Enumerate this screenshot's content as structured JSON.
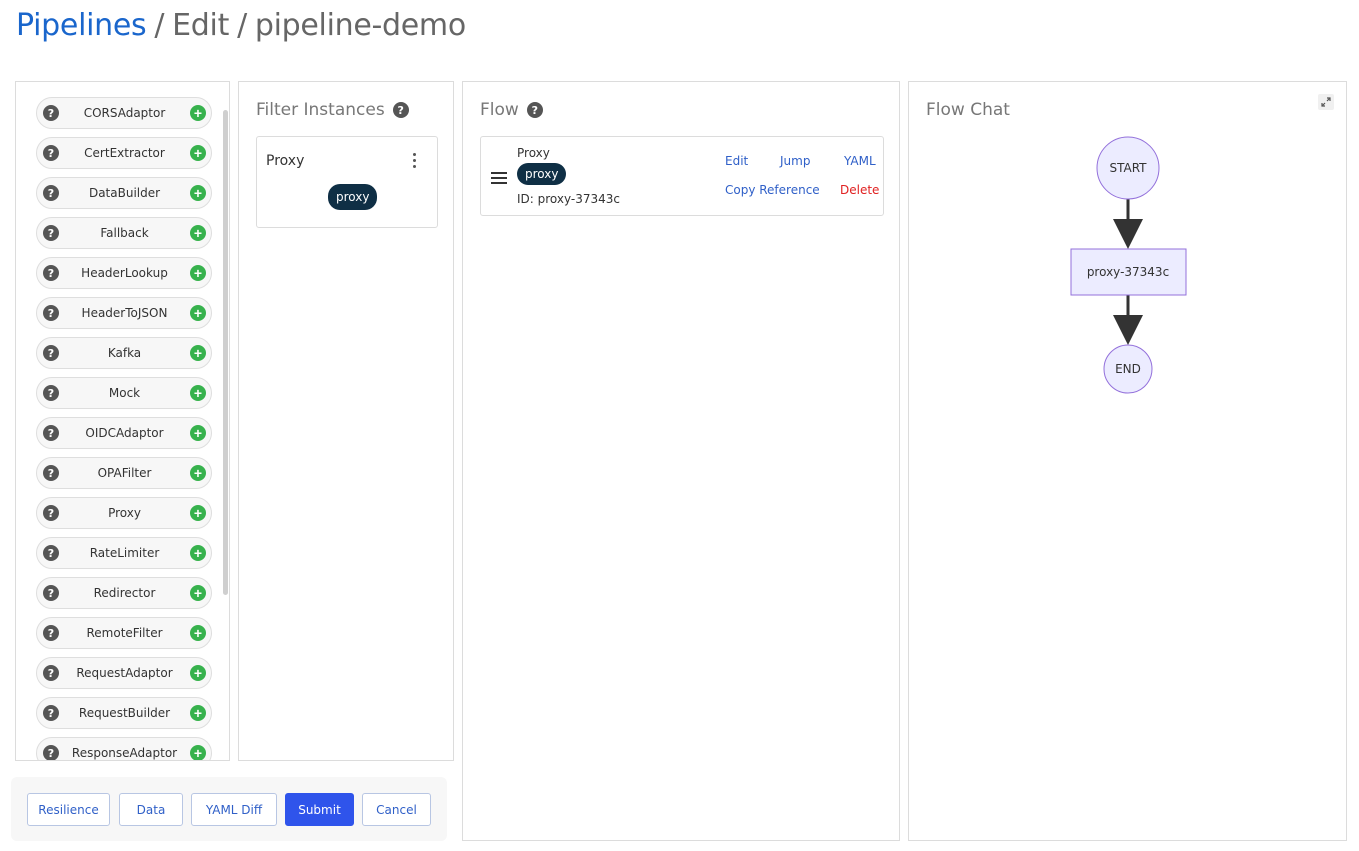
{
  "breadcrumb": {
    "root": "Pipelines",
    "separator": "/",
    "action": "Edit",
    "name": "pipeline-demo"
  },
  "filters": {
    "items": [
      "CORSAdaptor",
      "CertExtractor",
      "DataBuilder",
      "Fallback",
      "HeaderLookup",
      "HeaderToJSON",
      "Kafka",
      "Mock",
      "OIDCAdaptor",
      "OPAFilter",
      "Proxy",
      "RateLimiter",
      "Redirector",
      "RemoteFilter",
      "RequestAdaptor",
      "RequestBuilder",
      "ResponseAdaptor"
    ]
  },
  "instances": {
    "title": "Filter Instances",
    "card": {
      "kind": "Proxy",
      "tag": "proxy"
    }
  },
  "flow": {
    "title": "Flow",
    "card": {
      "kind": "Proxy",
      "tag": "proxy",
      "id_text": "ID: proxy-37343c",
      "actions": {
        "edit": "Edit",
        "jump": "Jump",
        "yaml": "YAML",
        "copy_reference": "Copy Reference",
        "delete": "Delete"
      }
    }
  },
  "chart": {
    "title": "Flow Chat",
    "start_label": "START",
    "node_label": "proxy-37343c",
    "end_label": "END"
  },
  "actions": {
    "resilience": "Resilience",
    "data": "Data",
    "yaml_diff": "YAML Diff",
    "submit": "Submit",
    "cancel": "Cancel"
  },
  "icons": {
    "help": "?",
    "add": "+"
  },
  "colors": {
    "link": "#1a66cc",
    "primary": "#2f54eb",
    "tag": "#0f2f45",
    "add": "#37b24d",
    "danger": "#e02020",
    "node_fill": "#ececff",
    "node_stroke": "#9370db"
  }
}
